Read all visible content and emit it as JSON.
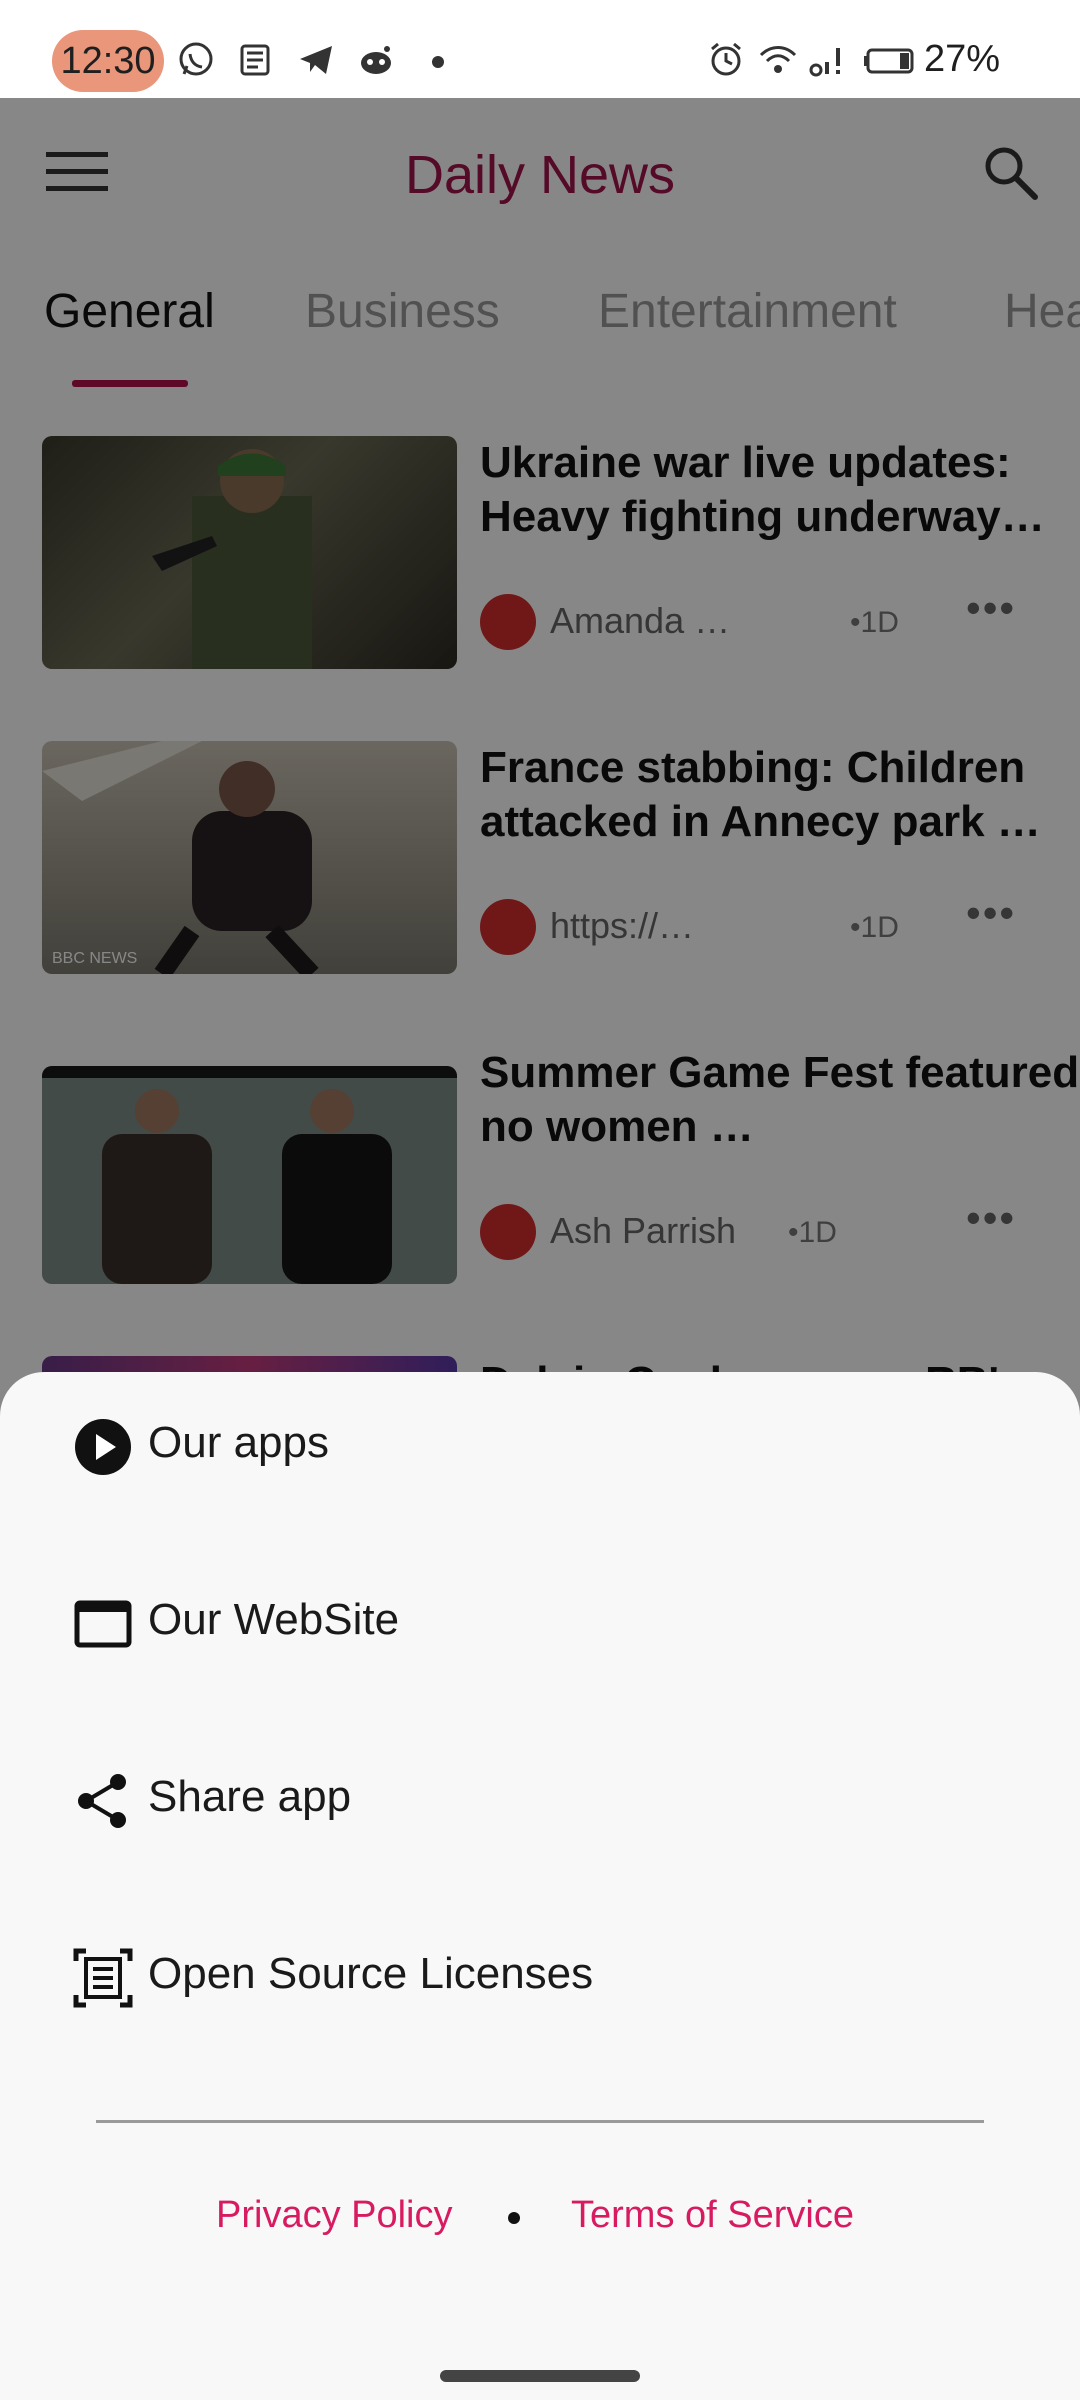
{
  "status_bar": {
    "time": "12:30",
    "battery": "27%",
    "left_icons": [
      "whatsapp-icon",
      "news-icon",
      "telegram-icon",
      "reddit-icon"
    ],
    "right_icons": [
      "alarm-icon",
      "wifi-icon",
      "signal-icon",
      "battery-icon"
    ]
  },
  "app": {
    "title": "Daily News",
    "accent_color": "#a0144a",
    "tabs": [
      "General",
      "Business",
      "Entertainment",
      "Hea"
    ],
    "active_tab": "General"
  },
  "news": [
    {
      "headline": "Ukraine war live updates: Heavy fighting underway…",
      "author": "Amanda …",
      "age": "•1D"
    },
    {
      "headline": "France stabbing: Children attacked in Annecy park …",
      "author": "https://…",
      "age": "•1D"
    },
    {
      "headline": "Summer Game Fest featured no women …",
      "author": "Ash Parrish",
      "age": "•1D"
    },
    {
      "headline": "Dalvin Cook rumors: RB's",
      "author": "",
      "age": ""
    }
  ],
  "sheet": {
    "items": [
      {
        "label": "Our apps",
        "icon": "play-circle-icon"
      },
      {
        "label": "Our WebSite",
        "icon": "browser-window-icon"
      },
      {
        "label": "Share app",
        "icon": "share-icon"
      },
      {
        "label": "Open Source Licenses",
        "icon": "document-scan-icon"
      }
    ],
    "privacy_link": "Privacy Policy",
    "terms_link": "Terms of Service",
    "link_color": "#d81b60"
  }
}
